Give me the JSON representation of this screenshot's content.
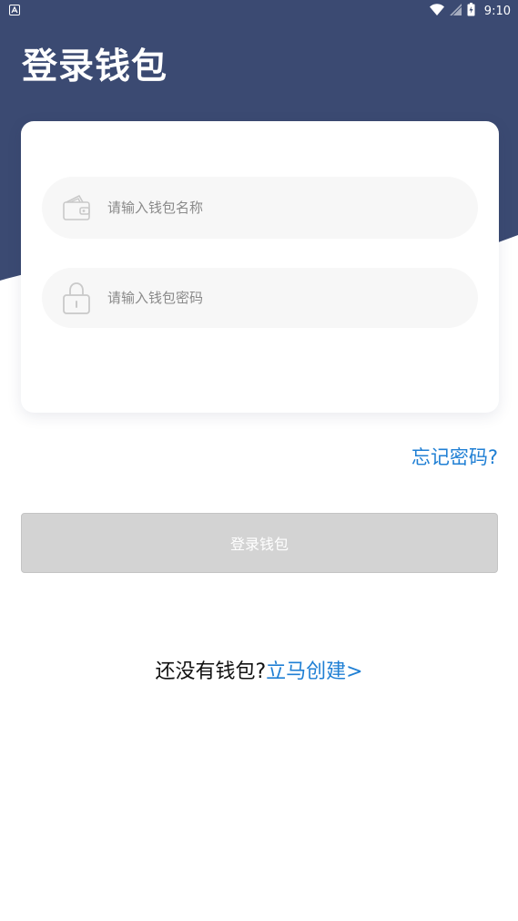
{
  "colors": {
    "header_bg": "#3b4a72",
    "accent": "#1f7fd4",
    "button_disabled": "#d3d3d3",
    "input_bg": "#f7f7f7"
  },
  "status_bar": {
    "time": "9:10",
    "icons": [
      "notification-a-icon",
      "wifi-icon",
      "signal-icon",
      "battery-icon"
    ]
  },
  "header": {
    "title": "登录钱包"
  },
  "form": {
    "wallet_name": {
      "placeholder": "请输入钱包名称",
      "value": "",
      "icon": "wallet-icon"
    },
    "password": {
      "placeholder": "请输入钱包密码",
      "value": "",
      "icon": "lock-icon"
    }
  },
  "links": {
    "forgot_password": "忘记密码?"
  },
  "actions": {
    "login_label": "登录钱包"
  },
  "register": {
    "prompt": "还没有钱包?",
    "link": "立马创建>"
  }
}
